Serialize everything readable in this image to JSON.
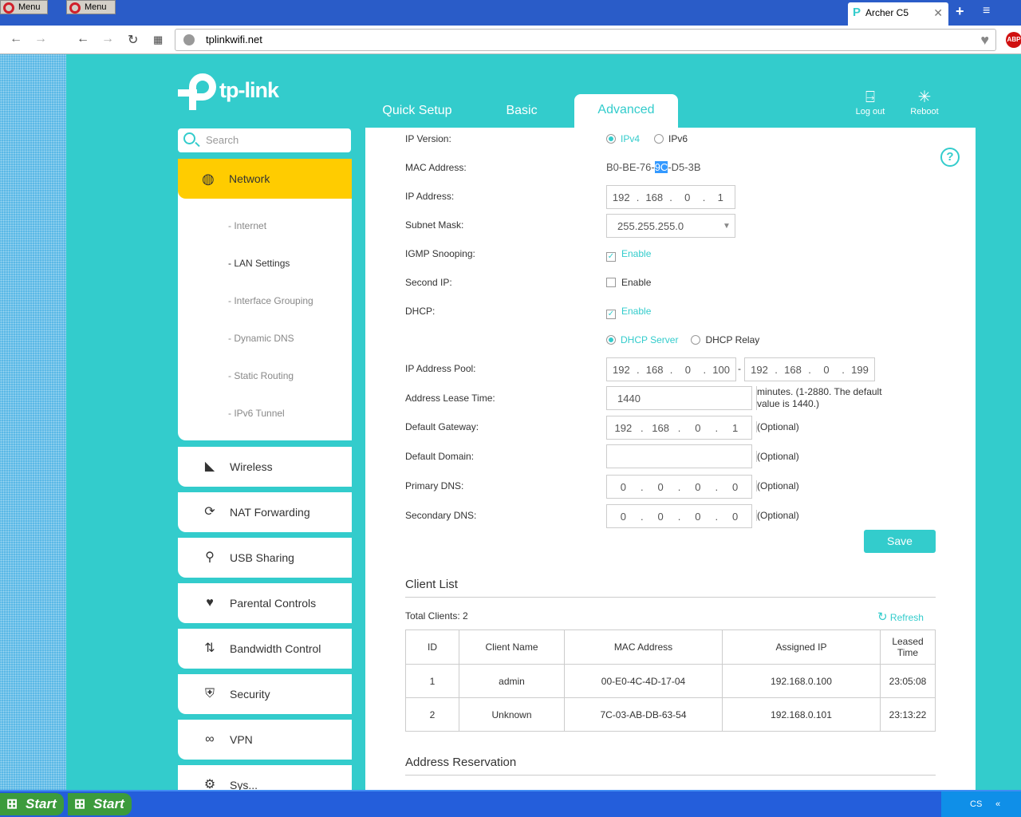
{
  "os": {
    "tabs": [
      "Menu",
      "Menu"
    ],
    "start_label": "Start",
    "tray_lang": "CS"
  },
  "browser": {
    "tab_title": "Archer C5",
    "url": "tplinkwifi.net",
    "icons": [
      "back-icon",
      "forward-icon",
      "reload-icon",
      "speed-dial-icon",
      "heart-icon",
      "adblock-icon"
    ],
    "abp_label": "ABP"
  },
  "header": {
    "logo": "tp-link",
    "tabs": [
      "Quick Setup",
      "Basic",
      "Advanced"
    ],
    "active_tab": "Advanced",
    "logout": "Log out",
    "reboot": "Reboot"
  },
  "sidebar": {
    "search_placeholder": "Search",
    "network": {
      "label": "Network",
      "items": [
        "- Internet",
        "- LAN Settings",
        "- Interface Grouping",
        "- Dynamic DNS",
        "- Static Routing",
        "- IPv6 Tunnel"
      ],
      "active": "- LAN Settings"
    },
    "items": [
      "Wireless",
      "NAT Forwarding",
      "USB Sharing",
      "Parental Controls",
      "Bandwidth Control",
      "Security",
      "VPN",
      "Sys..."
    ]
  },
  "form": {
    "ip_version": {
      "label": "IP Version:",
      "options": [
        "IPv4",
        "IPv6"
      ],
      "selected": "IPv4"
    },
    "mac": {
      "label": "MAC Address:",
      "pre": "B0-BE-76-",
      "sel": "9C",
      "post": "-D5-3B"
    },
    "ip": {
      "label": "IP Address:",
      "octets": [
        "192",
        "168",
        "0",
        "1"
      ]
    },
    "subnet": {
      "label": "Subnet Mask:",
      "value": "255.255.255.0"
    },
    "igmp": {
      "label": "IGMP Snooping:",
      "option": "Enable",
      "checked": true
    },
    "second_ip": {
      "label": "Second IP:",
      "option": "Enable",
      "checked": false
    },
    "dhcp": {
      "label": "DHCP:",
      "option": "Enable",
      "checked": true,
      "modes": [
        "DHCP Server",
        "DHCP Relay"
      ],
      "mode": "DHCP Server"
    },
    "pool": {
      "label": "IP Address Pool:",
      "start": [
        "192",
        "168",
        "0",
        "100"
      ],
      "end": [
        "192",
        "168",
        "0",
        "199"
      ],
      "sep": "-"
    },
    "lease": {
      "label": "Address Lease Time:",
      "value": "1440",
      "note": "minutes. (1-2880. The default value is 1440.)"
    },
    "gateway": {
      "label": "Default Gateway:",
      "octets": [
        "192",
        "168",
        "0",
        "1"
      ],
      "note": "(Optional)"
    },
    "domain": {
      "label": "Default Domain:",
      "value": "",
      "note": "(Optional)"
    },
    "dns1": {
      "label": "Primary DNS:",
      "octets": [
        "0",
        "0",
        "0",
        "0"
      ],
      "note": "(Optional)"
    },
    "dns2": {
      "label": "Secondary DNS:",
      "octets": [
        "0",
        "0",
        "0",
        "0"
      ],
      "note": "(Optional)"
    },
    "save": "Save"
  },
  "clients": {
    "title": "Client List",
    "total": "Total Clients: 2",
    "refresh": "Refresh",
    "columns": [
      "ID",
      "Client Name",
      "MAC Address",
      "Assigned IP",
      "Leased Time"
    ],
    "rows": [
      [
        "1",
        "admin",
        "00-E0-4C-4D-17-04",
        "192.168.0.100",
        "23:05:08"
      ],
      [
        "2",
        "Unknown",
        "7C-03-AB-DB-63-54",
        "192.168.0.101",
        "23:13:22"
      ]
    ]
  },
  "reservation": {
    "title": "Address Reservation"
  },
  "colors": {
    "accent": "#33cccc",
    "active": "#ffcc00"
  }
}
